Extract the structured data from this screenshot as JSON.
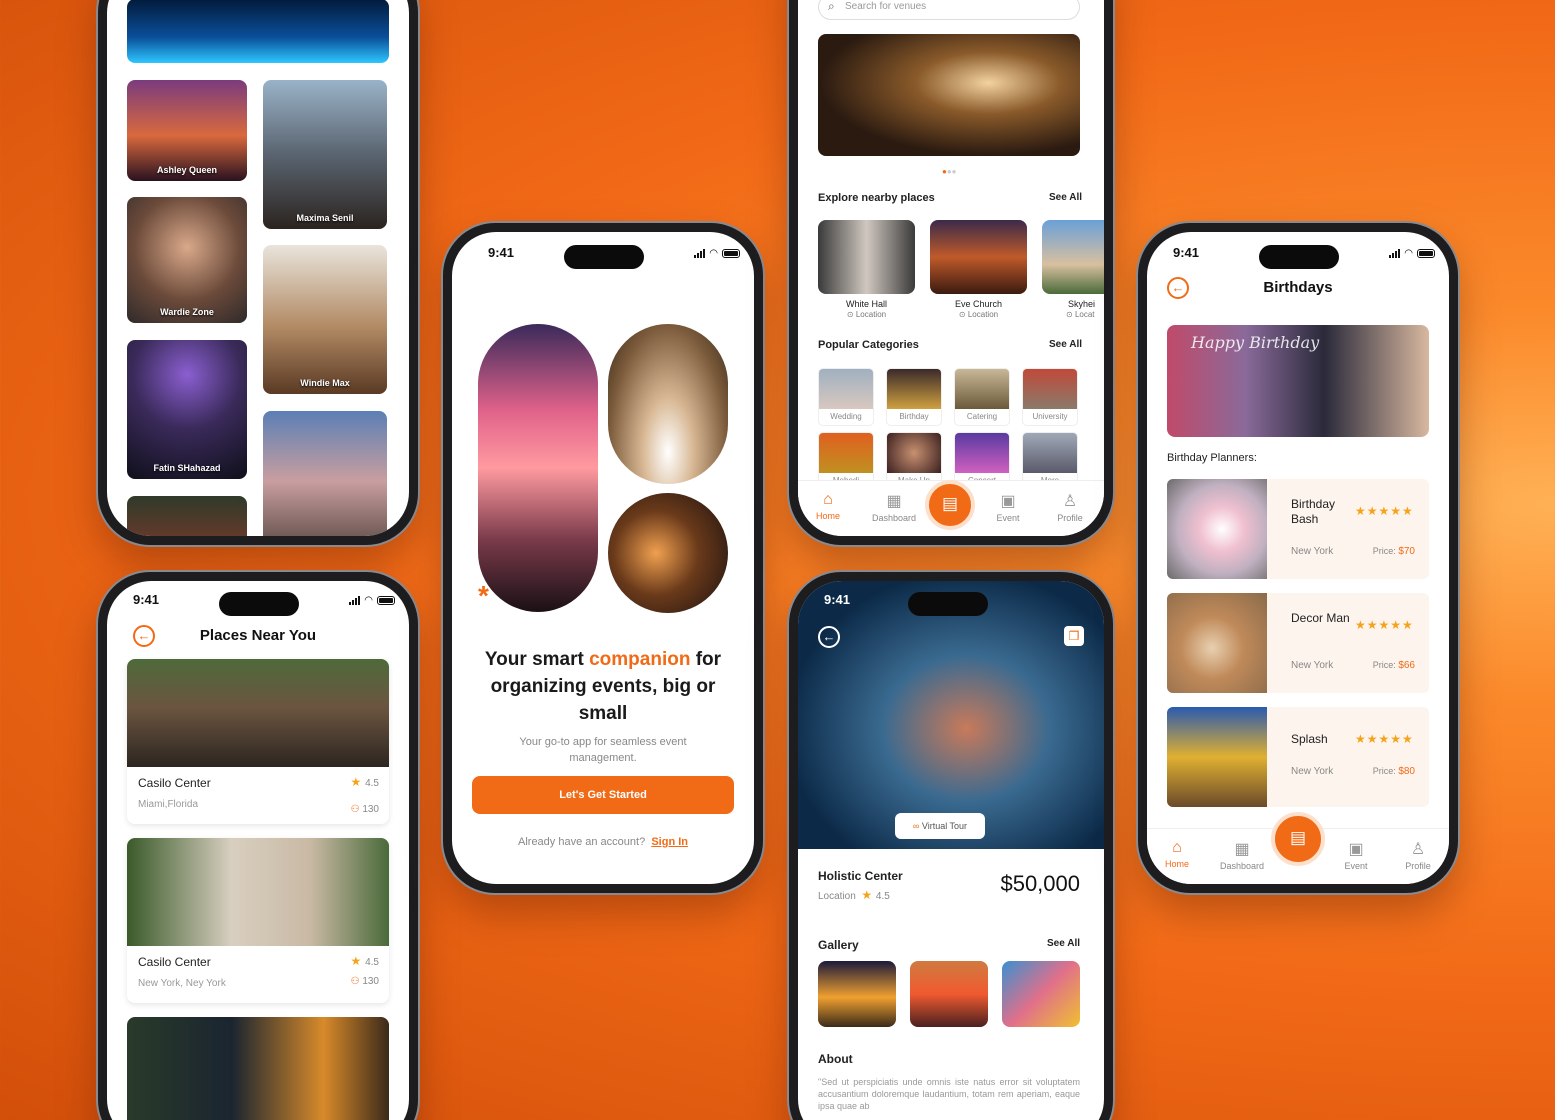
{
  "status_time": "9:41",
  "gallery": {
    "cards": [
      "Ashley Queen",
      "Maxima Senil",
      "Wardie Zone",
      "Windie Max",
      "Fatin SHahazad"
    ]
  },
  "places": {
    "title": "Places Near You",
    "items": [
      {
        "name": "Casilo Center",
        "location": "Miami,Florida",
        "rating": "4.5",
        "capacity": "130"
      },
      {
        "name": "Casilo Center",
        "location": "New York, Ney York",
        "rating": "4.5",
        "capacity": "130"
      }
    ]
  },
  "welcome": {
    "headline_pre": "Your smart ",
    "headline_accent": "companion",
    "headline_post": " for organizing events, big or small",
    "subtitle": "Your go-to app for seamless event management.",
    "cta": "Let's Get Started",
    "signin_prompt": "Already have an account?",
    "signin_link": "Sign In"
  },
  "home": {
    "search_placeholder": "Search for venues",
    "nearby_title": "Explore nearby places",
    "see_all": "See All",
    "nearby": [
      {
        "name": "White Hall",
        "loc": "Location"
      },
      {
        "name": "Eve Church",
        "loc": "Location"
      },
      {
        "name": "Skyhei",
        "loc": "Locat"
      }
    ],
    "categories_title": "Popular Categories",
    "categories": [
      "Wedding",
      "Birthday",
      "Catering",
      "University",
      "Mehedi",
      "Make Up",
      "Concert",
      "More"
    ]
  },
  "nav": {
    "home": "Home",
    "dashboard": "Dashboard",
    "event": "Event",
    "profile": "Profile"
  },
  "venue": {
    "virtual_tour": "Virtual Tour",
    "name": "Holistic Center",
    "location": "Location",
    "rating": "4.5",
    "price": "$50,000",
    "gallery_title": "Gallery",
    "see_all": "See All",
    "about_title": "About",
    "about_text": "\"Sed ut perspiciatis unde omnis iste natus error sit voluptatem accusantium doloremque laudantium, totam rem aperiam, eaque ipsa quae ab"
  },
  "birthdays": {
    "title": "Birthdays",
    "planners_title": "Birthday Planners:",
    "banner_text": "Happy Birthday",
    "planners": [
      {
        "name": "Birthday Bash",
        "city": "New York",
        "price_label": "Price:",
        "price": "$70"
      },
      {
        "name": "Decor Man",
        "city": "New York",
        "price_label": "Price:",
        "price": "$66"
      },
      {
        "name": "Splash",
        "city": "New York",
        "price_label": "Price:",
        "price": "$80"
      }
    ]
  },
  "colors": {
    "accent": "#f16a16",
    "star": "#f5a31a",
    "background": "#f26a17"
  }
}
